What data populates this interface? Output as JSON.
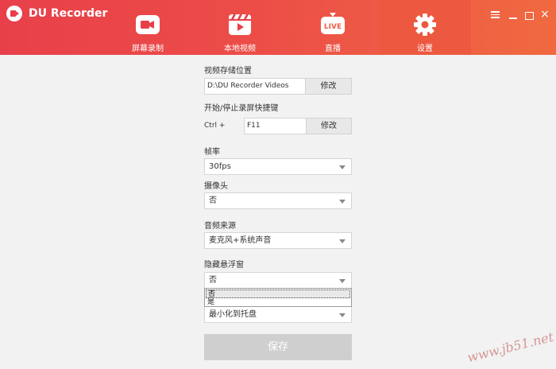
{
  "app": {
    "title": "DU Recorder"
  },
  "tabs": [
    {
      "label": "屏幕录制",
      "icon": "video-camera-icon"
    },
    {
      "label": "本地视频",
      "icon": "clapperboard-icon"
    },
    {
      "label": "直播",
      "icon": "live-icon",
      "badge": "LIVE"
    },
    {
      "label": "设置",
      "icon": "gear-icon",
      "active": true
    }
  ],
  "window_controls": {
    "close": "×"
  },
  "settings": {
    "storage": {
      "label": "视频存储位置",
      "value": "D:\\DU Recorder Videos",
      "button": "修改"
    },
    "hotkey": {
      "label": "开始/停止录屏快捷键",
      "prefix": "Ctrl  +",
      "value": "F11",
      "button": "修改"
    },
    "framerate": {
      "label": "帧率",
      "value": "30fps"
    },
    "camera": {
      "label": "摄像头",
      "value": "否"
    },
    "audio": {
      "label": "音频来源",
      "value": "麦克风+系统声音"
    },
    "floating": {
      "label": "隐藏悬浮窗",
      "value": "否",
      "options": [
        "否",
        "是"
      ]
    },
    "close_action": {
      "value": "最小化到托盘"
    },
    "save_button": "保存"
  },
  "watermark": "www.jb51.net",
  "colors": {
    "header_start": "#e8404a",
    "header_end": "#f0693f",
    "active_tab": "#ec5940",
    "save_disabled": "#cfcfcf"
  }
}
